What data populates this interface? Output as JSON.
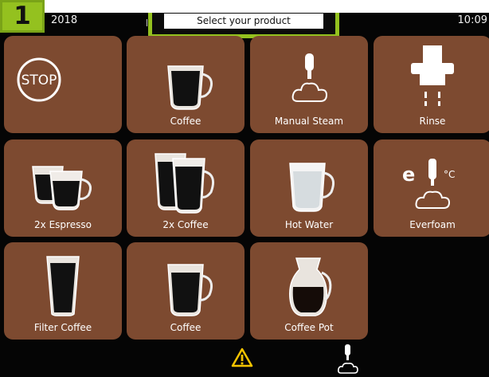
{
  "status": {
    "date": "2018",
    "time": "10:09"
  },
  "header": {
    "title": "Select your product",
    "step_number": "1"
  },
  "products": [
    {
      "label": "",
      "icon": "stop-icon"
    },
    {
      "label": "Coffee",
      "icon": "coffee-cup-icon"
    },
    {
      "label": "Manual Steam",
      "icon": "steam-wand-icon"
    },
    {
      "label": "Rinse",
      "icon": "rinse-icon"
    },
    {
      "label": "2x Espresso",
      "icon": "double-espresso-icon"
    },
    {
      "label": "2x Coffee",
      "icon": "double-coffee-icon"
    },
    {
      "label": "Hot Water",
      "icon": "hot-water-icon"
    },
    {
      "label": "Everfoam",
      "icon": "everfoam-icon",
      "unit": "°C"
    },
    {
      "label": "Filter Coffee",
      "icon": "filter-coffee-icon"
    },
    {
      "label": "Coffee",
      "icon": "coffee-cup-icon"
    },
    {
      "label": "Coffee Pot",
      "icon": "coffee-pot-icon"
    }
  ],
  "stop_label": "STOP",
  "everfoam_letter": "e",
  "bottom_bar": {
    "icons": [
      "warning-icon",
      "steam-wand-icon"
    ]
  },
  "colors": {
    "tile": "#7d4a30",
    "accent": "#94c11f",
    "background": "#050505"
  }
}
